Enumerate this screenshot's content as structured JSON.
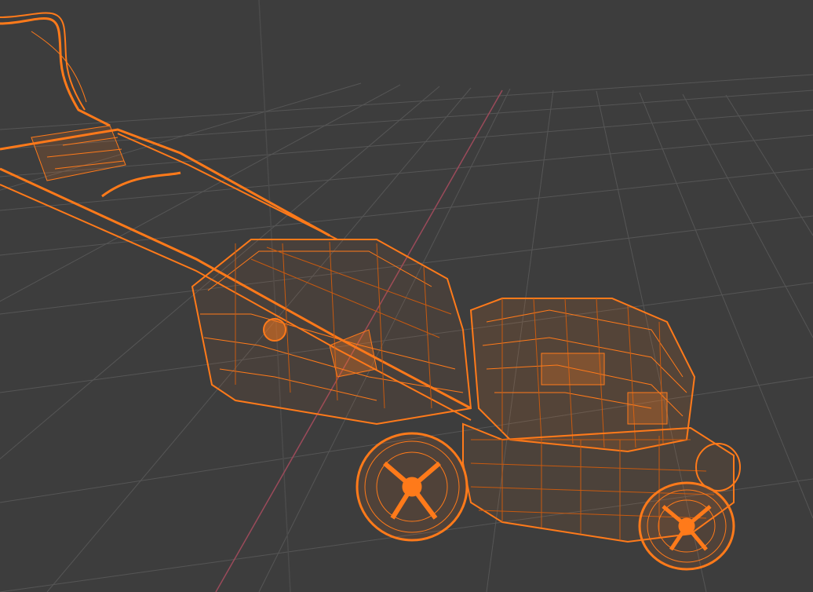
{
  "viewport": {
    "background": "#3d3d3d",
    "grid_color": "#5a5a5a",
    "grid_minor_color": "#4a4a4a",
    "axis_x_color": "#9a4a5a",
    "axis_y_color": "#4a4a4a",
    "wireframe_color": "#ff7a1a",
    "wireframe_dim_color": "#c85a10",
    "object_icon": "lawn-mower-icon",
    "shading_mode": "wireframe"
  }
}
